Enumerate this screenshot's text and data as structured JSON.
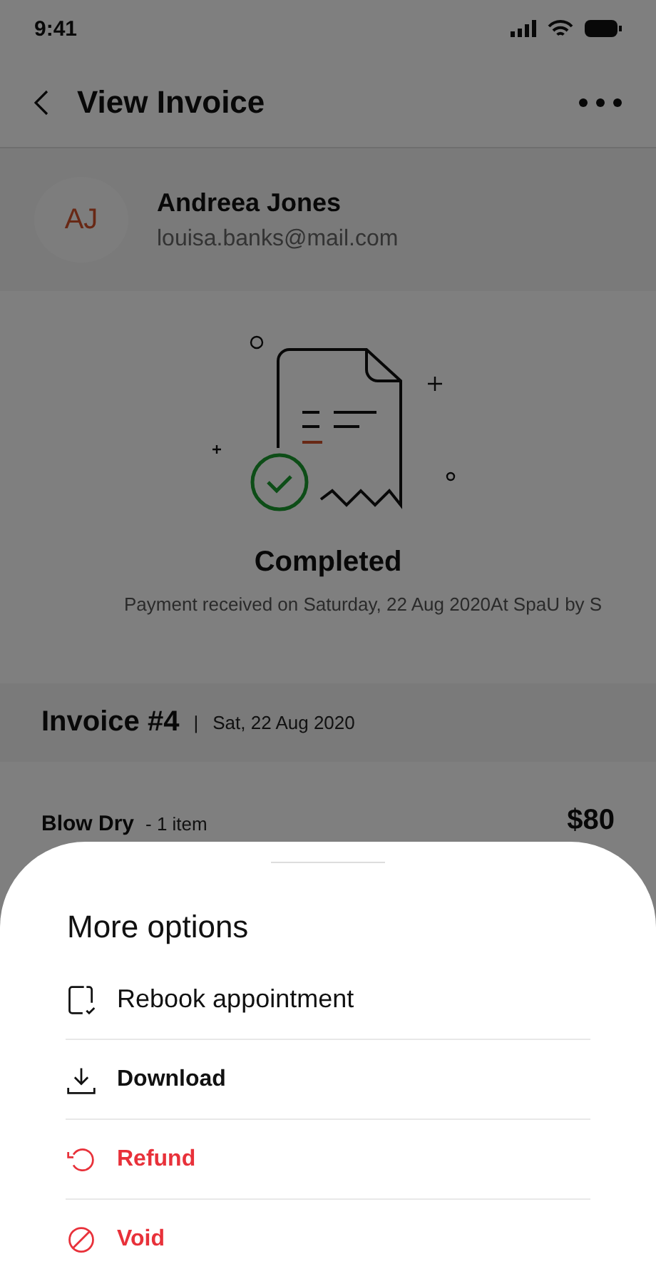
{
  "status_bar": {
    "time": "9:41"
  },
  "header": {
    "title": "View Invoice"
  },
  "customer": {
    "initials": "AJ",
    "name": "Andreea Jones",
    "email": "louisa.banks@mail.com"
  },
  "status": {
    "title": "Completed",
    "message": "Payment received on Saturday, 22 Aug 2020At SpaU by S"
  },
  "invoice": {
    "title": "Invoice #4",
    "separator": "|",
    "date": "Sat, 22 Aug 2020"
  },
  "line_item": {
    "name": "Blow Dry",
    "quantity": "- 1 item",
    "price": "$80"
  },
  "sheet": {
    "title": "More options",
    "items": [
      {
        "label": "Rebook appointment",
        "kind": "default"
      },
      {
        "label": "Download",
        "kind": "strong"
      },
      {
        "label": "Refund",
        "kind": "danger"
      },
      {
        "label": "Void",
        "kind": "danger"
      }
    ]
  }
}
